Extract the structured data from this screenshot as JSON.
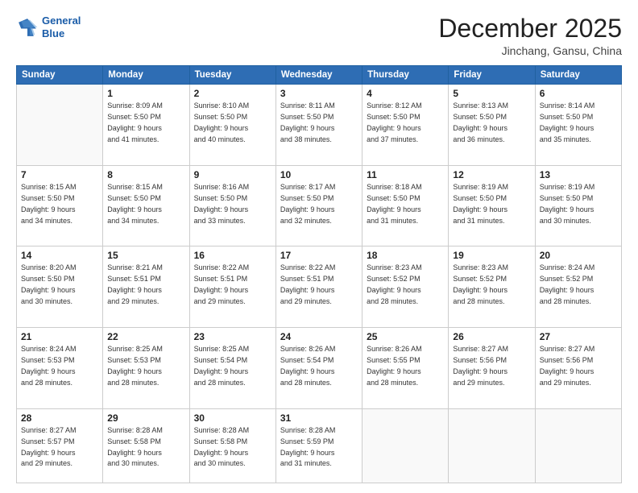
{
  "header": {
    "logo_line1": "General",
    "logo_line2": "Blue",
    "month": "December 2025",
    "location": "Jinchang, Gansu, China"
  },
  "weekdays": [
    "Sunday",
    "Monday",
    "Tuesday",
    "Wednesday",
    "Thursday",
    "Friday",
    "Saturday"
  ],
  "weeks": [
    [
      {
        "day": "",
        "info": ""
      },
      {
        "day": "1",
        "info": "Sunrise: 8:09 AM\nSunset: 5:50 PM\nDaylight: 9 hours\nand 41 minutes."
      },
      {
        "day": "2",
        "info": "Sunrise: 8:10 AM\nSunset: 5:50 PM\nDaylight: 9 hours\nand 40 minutes."
      },
      {
        "day": "3",
        "info": "Sunrise: 8:11 AM\nSunset: 5:50 PM\nDaylight: 9 hours\nand 38 minutes."
      },
      {
        "day": "4",
        "info": "Sunrise: 8:12 AM\nSunset: 5:50 PM\nDaylight: 9 hours\nand 37 minutes."
      },
      {
        "day": "5",
        "info": "Sunrise: 8:13 AM\nSunset: 5:50 PM\nDaylight: 9 hours\nand 36 minutes."
      },
      {
        "day": "6",
        "info": "Sunrise: 8:14 AM\nSunset: 5:50 PM\nDaylight: 9 hours\nand 35 minutes."
      }
    ],
    [
      {
        "day": "7",
        "info": "Sunrise: 8:15 AM\nSunset: 5:50 PM\nDaylight: 9 hours\nand 34 minutes."
      },
      {
        "day": "8",
        "info": "Sunrise: 8:15 AM\nSunset: 5:50 PM\nDaylight: 9 hours\nand 34 minutes."
      },
      {
        "day": "9",
        "info": "Sunrise: 8:16 AM\nSunset: 5:50 PM\nDaylight: 9 hours\nand 33 minutes."
      },
      {
        "day": "10",
        "info": "Sunrise: 8:17 AM\nSunset: 5:50 PM\nDaylight: 9 hours\nand 32 minutes."
      },
      {
        "day": "11",
        "info": "Sunrise: 8:18 AM\nSunset: 5:50 PM\nDaylight: 9 hours\nand 31 minutes."
      },
      {
        "day": "12",
        "info": "Sunrise: 8:19 AM\nSunset: 5:50 PM\nDaylight: 9 hours\nand 31 minutes."
      },
      {
        "day": "13",
        "info": "Sunrise: 8:19 AM\nSunset: 5:50 PM\nDaylight: 9 hours\nand 30 minutes."
      }
    ],
    [
      {
        "day": "14",
        "info": "Sunrise: 8:20 AM\nSunset: 5:50 PM\nDaylight: 9 hours\nand 30 minutes."
      },
      {
        "day": "15",
        "info": "Sunrise: 8:21 AM\nSunset: 5:51 PM\nDaylight: 9 hours\nand 29 minutes."
      },
      {
        "day": "16",
        "info": "Sunrise: 8:22 AM\nSunset: 5:51 PM\nDaylight: 9 hours\nand 29 minutes."
      },
      {
        "day": "17",
        "info": "Sunrise: 8:22 AM\nSunset: 5:51 PM\nDaylight: 9 hours\nand 29 minutes."
      },
      {
        "day": "18",
        "info": "Sunrise: 8:23 AM\nSunset: 5:52 PM\nDaylight: 9 hours\nand 28 minutes."
      },
      {
        "day": "19",
        "info": "Sunrise: 8:23 AM\nSunset: 5:52 PM\nDaylight: 9 hours\nand 28 minutes."
      },
      {
        "day": "20",
        "info": "Sunrise: 8:24 AM\nSunset: 5:52 PM\nDaylight: 9 hours\nand 28 minutes."
      }
    ],
    [
      {
        "day": "21",
        "info": "Sunrise: 8:24 AM\nSunset: 5:53 PM\nDaylight: 9 hours\nand 28 minutes."
      },
      {
        "day": "22",
        "info": "Sunrise: 8:25 AM\nSunset: 5:53 PM\nDaylight: 9 hours\nand 28 minutes."
      },
      {
        "day": "23",
        "info": "Sunrise: 8:25 AM\nSunset: 5:54 PM\nDaylight: 9 hours\nand 28 minutes."
      },
      {
        "day": "24",
        "info": "Sunrise: 8:26 AM\nSunset: 5:54 PM\nDaylight: 9 hours\nand 28 minutes."
      },
      {
        "day": "25",
        "info": "Sunrise: 8:26 AM\nSunset: 5:55 PM\nDaylight: 9 hours\nand 28 minutes."
      },
      {
        "day": "26",
        "info": "Sunrise: 8:27 AM\nSunset: 5:56 PM\nDaylight: 9 hours\nand 29 minutes."
      },
      {
        "day": "27",
        "info": "Sunrise: 8:27 AM\nSunset: 5:56 PM\nDaylight: 9 hours\nand 29 minutes."
      }
    ],
    [
      {
        "day": "28",
        "info": "Sunrise: 8:27 AM\nSunset: 5:57 PM\nDaylight: 9 hours\nand 29 minutes."
      },
      {
        "day": "29",
        "info": "Sunrise: 8:28 AM\nSunset: 5:58 PM\nDaylight: 9 hours\nand 30 minutes."
      },
      {
        "day": "30",
        "info": "Sunrise: 8:28 AM\nSunset: 5:58 PM\nDaylight: 9 hours\nand 30 minutes."
      },
      {
        "day": "31",
        "info": "Sunrise: 8:28 AM\nSunset: 5:59 PM\nDaylight: 9 hours\nand 31 minutes."
      },
      {
        "day": "",
        "info": ""
      },
      {
        "day": "",
        "info": ""
      },
      {
        "day": "",
        "info": ""
      }
    ]
  ]
}
